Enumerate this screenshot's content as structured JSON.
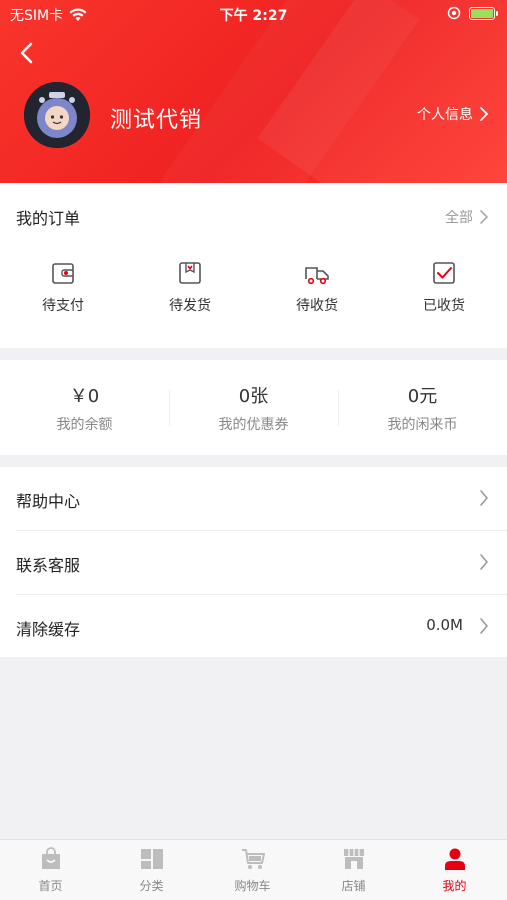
{
  "status_bar": {
    "carrier": "无SIM卡",
    "time": "下午 2:27"
  },
  "header": {
    "username": "测试代销",
    "profile_link": "个人信息"
  },
  "orders": {
    "title": "我的订单",
    "all_link": "全部",
    "items": [
      {
        "label": "待支付",
        "icon": "wallet-icon"
      },
      {
        "label": "待发货",
        "icon": "package-icon"
      },
      {
        "label": "待收货",
        "icon": "truck-icon"
      },
      {
        "label": "已收货",
        "icon": "check-box-icon"
      }
    ]
  },
  "assets": [
    {
      "value": "￥0",
      "name": "我的余额"
    },
    {
      "value": "0张",
      "name": "我的优惠券"
    },
    {
      "value": "0元",
      "name": "我的闲来币"
    }
  ],
  "menu": [
    {
      "label": "帮助中心",
      "value": ""
    },
    {
      "label": "联系客服",
      "value": ""
    },
    {
      "label": "清除缓存",
      "value": "0.0M"
    }
  ],
  "tabbar": [
    {
      "label": "首页",
      "icon": "home-bag-icon",
      "active": false
    },
    {
      "label": "分类",
      "icon": "category-icon",
      "active": false
    },
    {
      "label": "购物车",
      "icon": "cart-icon",
      "active": false
    },
    {
      "label": "店铺",
      "icon": "store-icon",
      "active": false
    },
    {
      "label": "我的",
      "icon": "user-icon",
      "active": true
    }
  ],
  "colors": {
    "accent": "#e60012",
    "header": "#f22a24",
    "icon_gray": "#bdbdbd"
  }
}
